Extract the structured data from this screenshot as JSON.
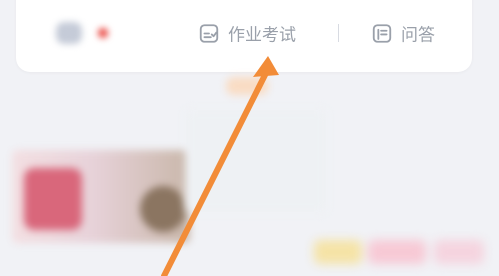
{
  "tabs": [
    {
      "label": "",
      "icon": "blurred-icon",
      "blurred": true,
      "has_badge": true
    },
    {
      "label": "作业考试",
      "icon": "homework-exam-icon"
    },
    {
      "label": "问答",
      "icon": "qa-icon"
    }
  ],
  "section": {
    "title": ""
  },
  "colors": {
    "arrow": "#f28c38",
    "badge": "#e9423c",
    "tab_text": "#9aa0aa"
  }
}
